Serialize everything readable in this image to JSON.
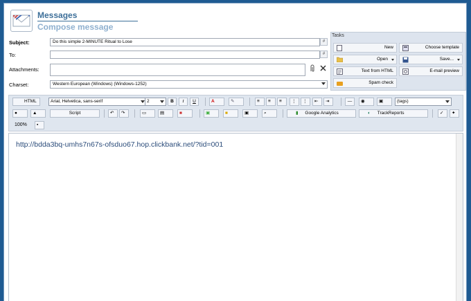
{
  "header": {
    "title": "Messages",
    "subtitle": "Compose message"
  },
  "form": {
    "subject_label": "Subject:",
    "subject_value": "Do this simple 2-MINUTE Ritual to Lose",
    "to_label": "To:",
    "to_value": "",
    "attachments_label": "Attachments:",
    "charset_label": "Charset:",
    "charset_value": "Western European (Windows)      (Windows-1252)"
  },
  "tasks": {
    "label": "Tasks",
    "buttons": {
      "new": "New",
      "choose_template": "Choose template",
      "open": "Open",
      "save": "Save...",
      "text_from_html": "Text from HTML",
      "email_preview": "E-mail preview",
      "spam_check": "Spam check"
    }
  },
  "toolbar": {
    "html_label": "HTML",
    "font_family": "Arial, Helvetica, sans-serif",
    "font_size": "2",
    "bold": "B",
    "italic": "I",
    "underline": "U",
    "tags": "(tags)",
    "script": "Script",
    "google_analytics": "Google Analytics",
    "track_reports": "TrackReports",
    "zoom": "100%"
  },
  "editor": {
    "content": "http://bdda3bq-umhs7n67s-ofsduo67.hop.clickbank.net/?tid=001"
  },
  "colors": {
    "background": "#1f5b92",
    "accent": "#3d6f99",
    "subtitle": "#8fb0cf",
    "link": "#2b4c7a"
  }
}
